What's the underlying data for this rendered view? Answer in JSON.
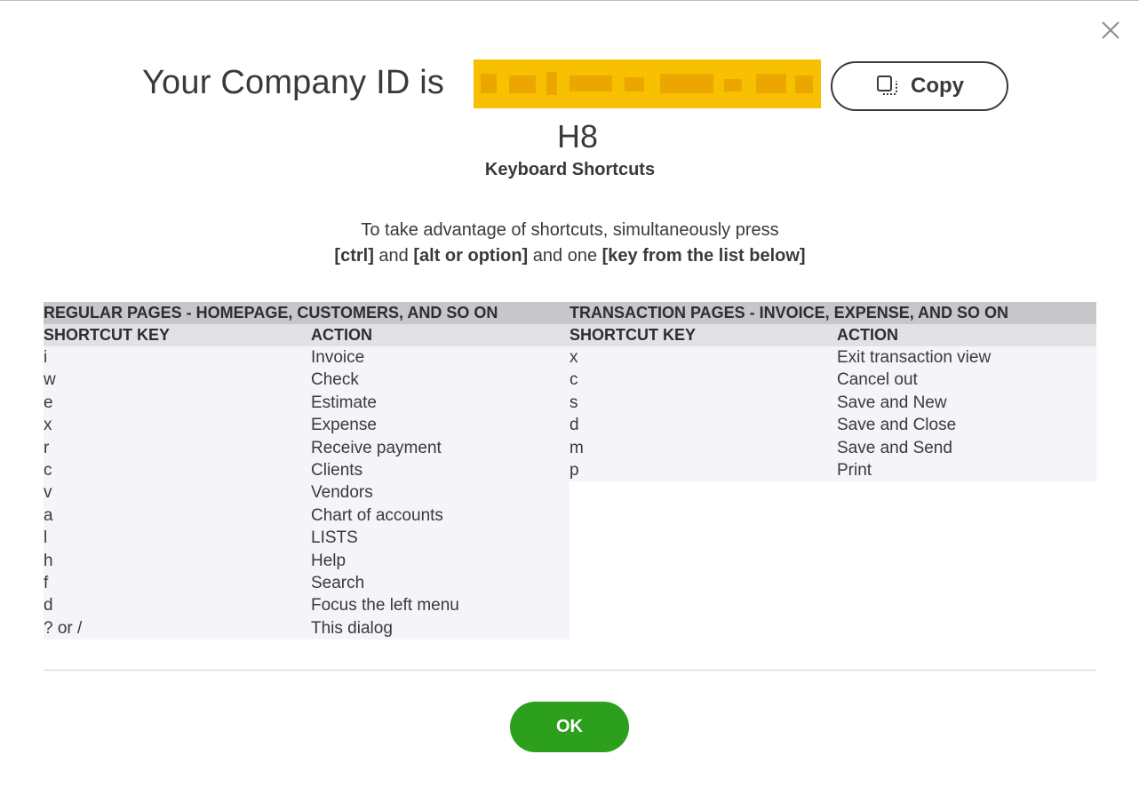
{
  "dialog": {
    "close_icon": "close-icon",
    "company_id_prefix": "Your Company ID is",
    "company_id_suffix": "H8",
    "copy_label": "Copy",
    "copy_icon": "copy-icon",
    "title": "Keyboard Shortcuts",
    "instructions": {
      "line1": "To take advantage of shortcuts, simultaneously press",
      "ctrl": "[ctrl]",
      "and1": " and ",
      "alt": "[alt or option]",
      "and2": " and one ",
      "key": "[key from the list below]"
    },
    "ok_label": "OK",
    "colors": {
      "ok_green": "#2ca01c",
      "id_highlight": "#f7c000"
    }
  },
  "regular": {
    "section_title": "REGULAR PAGES - HOMEPAGE, CUSTOMERS, AND SO ON",
    "col_key": "SHORTCUT KEY",
    "col_action": "ACTION",
    "rows": [
      {
        "key": "i",
        "action": "Invoice"
      },
      {
        "key": "w",
        "action": "Check"
      },
      {
        "key": "e",
        "action": "Estimate"
      },
      {
        "key": "x",
        "action": "Expense"
      },
      {
        "key": "r",
        "action": "Receive payment"
      },
      {
        "key": "c",
        "action": "Clients"
      },
      {
        "key": "v",
        "action": "Vendors"
      },
      {
        "key": "a",
        "action": "Chart of accounts"
      },
      {
        "key": "l",
        "action": "LISTS"
      },
      {
        "key": "h",
        "action": "Help"
      },
      {
        "key": "f",
        "action": "Search"
      },
      {
        "key": "d",
        "action": "Focus the left menu"
      },
      {
        "key": "? or /",
        "action": "This dialog"
      }
    ]
  },
  "transaction": {
    "section_title": "TRANSACTION PAGES - INVOICE, EXPENSE, AND SO ON",
    "col_key": "SHORTCUT KEY",
    "col_action": "ACTION",
    "rows": [
      {
        "key": "x",
        "action": "Exit transaction view"
      },
      {
        "key": "c",
        "action": "Cancel out"
      },
      {
        "key": "s",
        "action": "Save and New"
      },
      {
        "key": "d",
        "action": "Save and Close"
      },
      {
        "key": "m",
        "action": "Save and Send"
      },
      {
        "key": "p",
        "action": "Print"
      }
    ]
  }
}
